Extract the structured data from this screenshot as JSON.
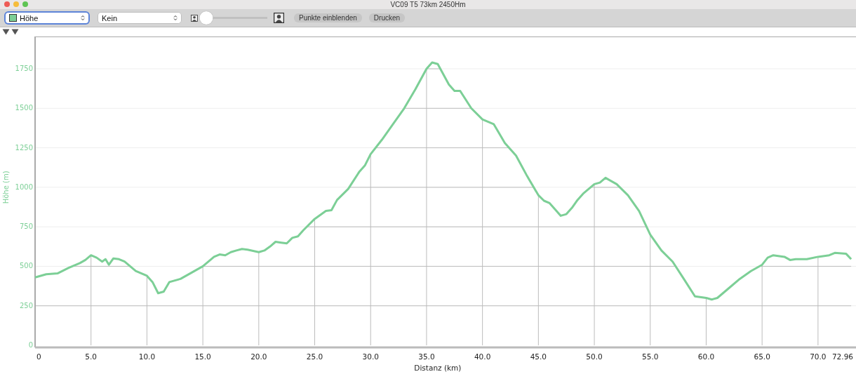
{
  "window": {
    "title": "VC09 T5 73km 2450Hm"
  },
  "toolbar": {
    "series_select": {
      "color": "#7ccf96",
      "focused": true
    },
    "secondary_select": {
      "value": "Kein"
    },
    "zoom_slider": {
      "level": 0.05
    },
    "buttons": [
      "Punkte einblenden",
      "Drucken"
    ]
  },
  "chart": {
    "chart_data": {
      "type": "line",
      "xlabel": "Distanz (km)",
      "ylabel": "Höhe (m)",
      "xlim": [
        0,
        73.27
      ],
      "ylim": [
        0,
        1950
      ],
      "grid": true,
      "ref_lines": [
        {
          "axis": "x",
          "value": 5
        },
        {
          "axis": "x",
          "value": 10
        },
        {
          "axis": "x",
          "value": 15
        },
        {
          "axis": "x",
          "value": 20
        },
        {
          "axis": "x",
          "value": 25
        },
        {
          "axis": "x",
          "value": 30
        },
        {
          "axis": "x",
          "value": 35
        },
        {
          "axis": "x",
          "value": 40
        },
        {
          "axis": "x",
          "value": 45
        },
        {
          "axis": "x",
          "value": 50
        },
        {
          "axis": "x",
          "value": 55
        },
        {
          "axis": "x",
          "value": 60
        },
        {
          "axis": "x",
          "value": 65
        },
        {
          "axis": "x",
          "value": 70
        }
      ],
      "xticks": [
        0,
        {
          "value": 5,
          "label": "5.0"
        },
        {
          "value": 10,
          "label": "10.0"
        },
        {
          "value": 15,
          "label": "15.0"
        },
        {
          "value": 20,
          "label": "20.0"
        },
        {
          "value": 25,
          "label": "25.0"
        },
        {
          "value": 30,
          "label": "30.0"
        },
        {
          "value": 35,
          "label": "35.0"
        },
        {
          "value": 40,
          "label": "40.0"
        },
        {
          "value": 45,
          "label": "45.0"
        },
        {
          "value": 50,
          "label": "50.0"
        },
        {
          "value": 55,
          "label": "55.0"
        },
        {
          "value": 60,
          "label": "60.0"
        },
        {
          "value": 65,
          "label": "65.0"
        },
        {
          "value": 70,
          "label": "70.0"
        },
        {
          "value": 72.96,
          "label": "72.96"
        }
      ],
      "yticks": [
        0,
        250,
        500,
        750,
        1000,
        1250,
        1500,
        1750
      ],
      "x": [
        0,
        1,
        2,
        3,
        4,
        4.5,
        5,
        5.5,
        6,
        6.3,
        6.6,
        7,
        7.5,
        8,
        8.5,
        9,
        10,
        10.5,
        11,
        11.5,
        12,
        13,
        14,
        15,
        15.5,
        16,
        16.5,
        17,
        17.5,
        18,
        18.5,
        19,
        20,
        20.5,
        21,
        21.5,
        22,
        22.5,
        23,
        23.5,
        24,
        25,
        26,
        26.5,
        27,
        28,
        29,
        29.5,
        30,
        31,
        32,
        33,
        34,
        35,
        35.5,
        36,
        37,
        37.5,
        38,
        39,
        40,
        41,
        41.5,
        42,
        43,
        44,
        45,
        45.5,
        46,
        46.5,
        47,
        47.5,
        48,
        48.5,
        49,
        50,
        50.5,
        51,
        52,
        53,
        54,
        55,
        56,
        57,
        58,
        59,
        60,
        60.5,
        61,
        62,
        63,
        64,
        65,
        65.5,
        66,
        67,
        67.5,
        68,
        69,
        70,
        71,
        71.5,
        72.5,
        72.96
      ],
      "series": [
        {
          "name": "Höhe",
          "color": "#7ccf96",
          "values": [
            430,
            450,
            455,
            490,
            520,
            540,
            570,
            555,
            530,
            545,
            510,
            550,
            545,
            530,
            500,
            470,
            440,
            400,
            330,
            340,
            400,
            420,
            460,
            500,
            530,
            560,
            575,
            570,
            590,
            600,
            610,
            605,
            590,
            600,
            625,
            655,
            650,
            645,
            680,
            690,
            730,
            800,
            850,
            855,
            920,
            990,
            1100,
            1140,
            1210,
            1300,
            1400,
            1500,
            1620,
            1750,
            1790,
            1780,
            1650,
            1610,
            1610,
            1500,
            1430,
            1400,
            1340,
            1280,
            1200,
            1070,
            950,
            915,
            900,
            860,
            820,
            830,
            870,
            920,
            960,
            1020,
            1030,
            1060,
            1020,
            950,
            850,
            700,
            600,
            530,
            420,
            310,
            300,
            290,
            300,
            360,
            420,
            470,
            510,
            555,
            570,
            560,
            540,
            545,
            545,
            560,
            570,
            585,
            580,
            545
          ]
        }
      ]
    }
  }
}
